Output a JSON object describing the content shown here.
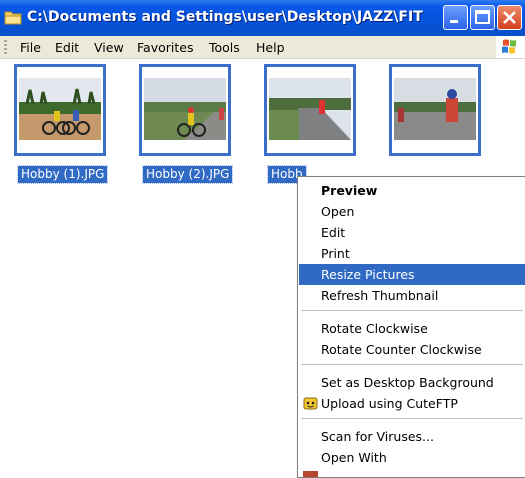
{
  "window": {
    "title": "C:\\Documents and Settings\\user\\Desktop\\JAZZ\\FIT",
    "icon": "folder-icon",
    "buttons": [
      "minimize",
      "maximize",
      "close"
    ]
  },
  "menubar": {
    "items": [
      "File",
      "Edit",
      "View",
      "Favorites",
      "Tools",
      "Help"
    ]
  },
  "files": [
    {
      "name": "Hobby (1).JPG",
      "selected": true
    },
    {
      "name": "Hobby (2).JPG",
      "selected": true
    },
    {
      "name": "Hobb",
      "selected": true
    },
    {
      "name": "",
      "selected": true
    }
  ],
  "context_menu": {
    "items": [
      {
        "label": "Preview",
        "bold": true
      },
      {
        "label": "Open"
      },
      {
        "label": "Edit"
      },
      {
        "label": "Print"
      },
      {
        "label": "Resize Pictures",
        "highlighted": true
      },
      {
        "label": "Refresh Thumbnail"
      },
      {
        "separator": true
      },
      {
        "label": "Rotate Clockwise"
      },
      {
        "label": "Rotate Counter Clockwise"
      },
      {
        "separator": true
      },
      {
        "label": "Set as Desktop Background"
      },
      {
        "label": "Upload using CuteFTP",
        "icon": "cuteftp-icon"
      },
      {
        "separator": true
      },
      {
        "label": "Scan for Viruses..."
      },
      {
        "label": "Open With"
      }
    ]
  },
  "colors": {
    "titlebar": "#0453da",
    "selection": "#316ac5",
    "menubar": "#ece9d8"
  }
}
